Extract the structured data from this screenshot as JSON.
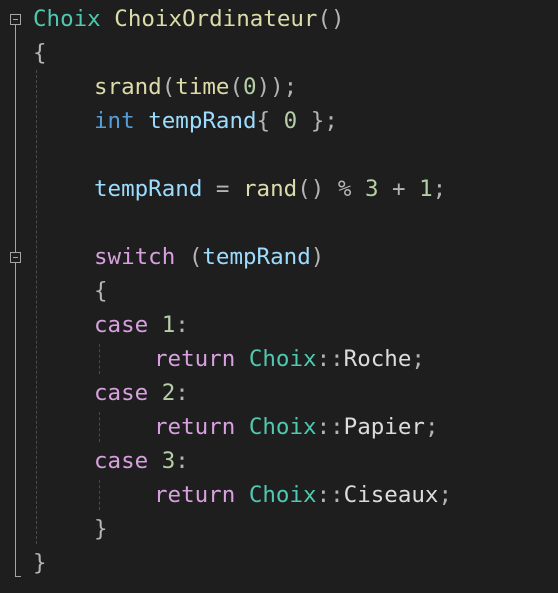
{
  "editor": {
    "language": "C++",
    "colors": {
      "background": "#1e1e1e",
      "type": "#4ec9b0",
      "function": "#dcdcaa",
      "keyword": "#569cd6",
      "control": "#d8a0df",
      "variable": "#9cdcfe",
      "number": "#b5cea8",
      "punctuation": "#b4b4b4"
    },
    "code": {
      "l1": {
        "type": "Choix",
        "name": "ChoixOrdinateur",
        "parens": "()"
      },
      "l2": {
        "brace": "{"
      },
      "l3": {
        "func": "srand",
        "open": "(",
        "func2": "time",
        "open2": "(",
        "arg": "0",
        "close": "));"
      },
      "l4": {
        "kw": "int",
        "var": "tempRand",
        "open": "{",
        "num": "0",
        "close": "};"
      },
      "l6": {
        "var": "tempRand",
        "assign": "=",
        "func": "rand",
        "parens": "()",
        "mod": "%",
        "n1": "3",
        "plus": "+",
        "n2": "1",
        "semi": ";"
      },
      "l8": {
        "kw": "switch",
        "open": "(",
        "var": "tempRand",
        "close": ")"
      },
      "l9": {
        "brace": "{"
      },
      "l10": {
        "kw": "case",
        "num": "1",
        "colon": ":"
      },
      "l11": {
        "kw": "return",
        "type": "Choix",
        "scope": "::",
        "member": "Roche",
        "semi": ";"
      },
      "l12": {
        "kw": "case",
        "num": "2",
        "colon": ":"
      },
      "l13": {
        "kw": "return",
        "type": "Choix",
        "scope": "::",
        "member": "Papier",
        "semi": ";"
      },
      "l14": {
        "kw": "case",
        "num": "3",
        "colon": ":"
      },
      "l15": {
        "kw": "return",
        "type": "Choix",
        "scope": "::",
        "member": "Ciseaux",
        "semi": ";"
      },
      "l16": {
        "brace": "}"
      },
      "l17": {
        "brace": "}"
      }
    }
  }
}
